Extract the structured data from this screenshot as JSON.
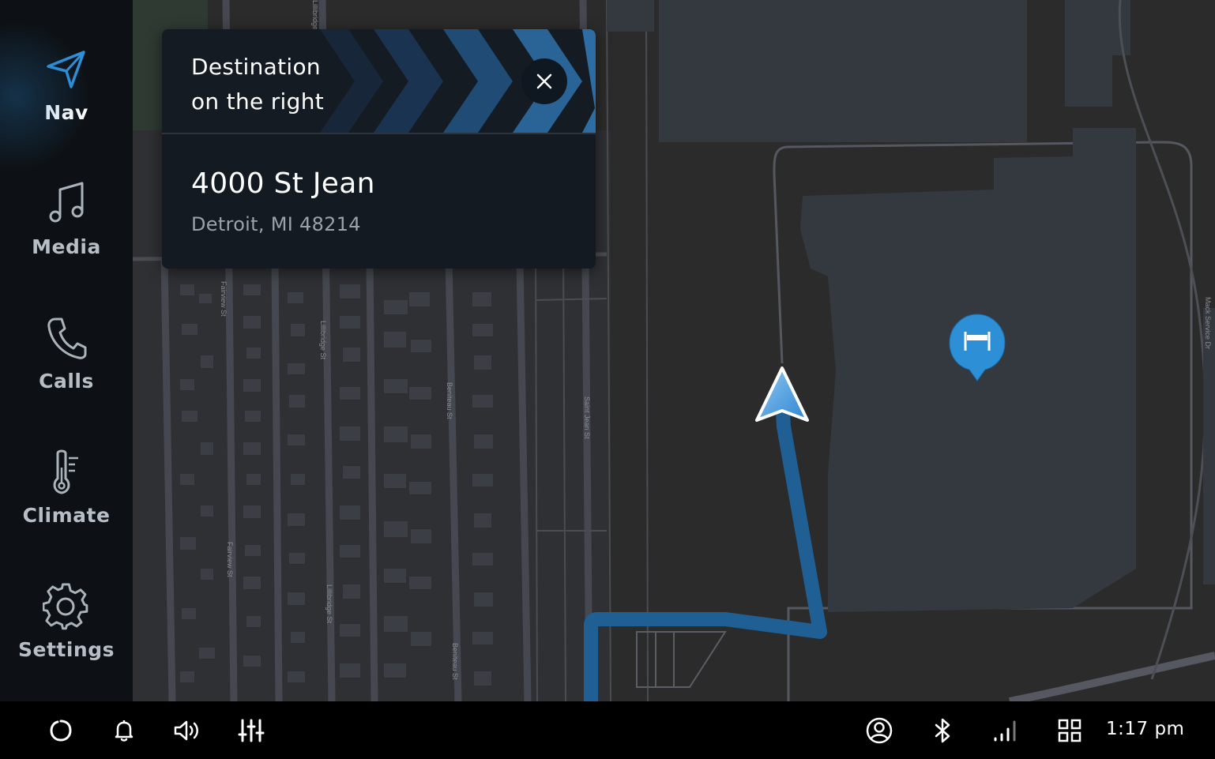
{
  "sidebar": {
    "items": [
      {
        "label": "Nav",
        "icon": "navigation-arrow-icon",
        "active": true
      },
      {
        "label": "Media",
        "icon": "music-note-icon",
        "active": false
      },
      {
        "label": "Calls",
        "icon": "phone-icon",
        "active": false
      },
      {
        "label": "Climate",
        "icon": "thermometer-icon",
        "active": false
      },
      {
        "label": "Settings",
        "icon": "gear-icon",
        "active": false
      }
    ]
  },
  "navigation": {
    "maneuver_line1": "Destination",
    "maneuver_line2": "on the right",
    "close_icon": "close-icon",
    "destination_address": "4000 St Jean",
    "destination_city": "Detroit, MI 48214"
  },
  "map": {
    "street_labels": {
      "fairview_1": "Fairview St",
      "fairview_2": "Fairview St",
      "lillibridge_1": "Lillibridge St",
      "lillibridge_2": "Lillibridge St",
      "lillibridge_top": "Lillibridge St",
      "beniteau_1": "Beniteau St",
      "beniteau_2": "Beniteau St",
      "saint_jean": "Saint Jean St",
      "mack_service": "Mack Service Dr"
    },
    "destination_marker_icon": "hotel-bed-icon",
    "vehicle_icon": "vehicle-position-arrow-icon",
    "route_color": "#1f6fb0"
  },
  "status_bar": {
    "left_icons": [
      "voice-assistant-icon",
      "bell-icon",
      "volume-icon",
      "equalizer-icon"
    ],
    "right_icons": [
      "user-profile-icon",
      "bluetooth-icon",
      "signal-strength-icon",
      "apps-grid-icon"
    ],
    "time": "1:17 pm"
  },
  "colors": {
    "accent": "#2f8fd8",
    "sidebar_bg": "#0d1115",
    "map_bg": "#2b2b2b",
    "building": "#34383f"
  }
}
